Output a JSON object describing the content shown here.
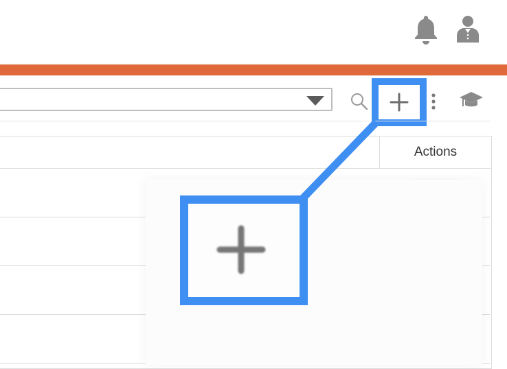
{
  "header": {
    "icons": [
      "bell-icon",
      "user-icon"
    ]
  },
  "colors": {
    "accent_strip": "#e0693a",
    "highlight": "#3f8ff2",
    "icon": "#8a8a8a"
  },
  "toolbar": {
    "select_value": "",
    "icons": [
      "search-icon",
      "plus-icon",
      "kebab-menu-icon",
      "graduation-cap-icon"
    ]
  },
  "table": {
    "columns": [
      "",
      "Actions"
    ],
    "rows": [
      {
        "actions": ""
      },
      {
        "actions": ""
      },
      {
        "actions": ""
      },
      {
        "actions": ""
      }
    ]
  },
  "zoom_callout": {
    "icon": "plus-icon"
  }
}
